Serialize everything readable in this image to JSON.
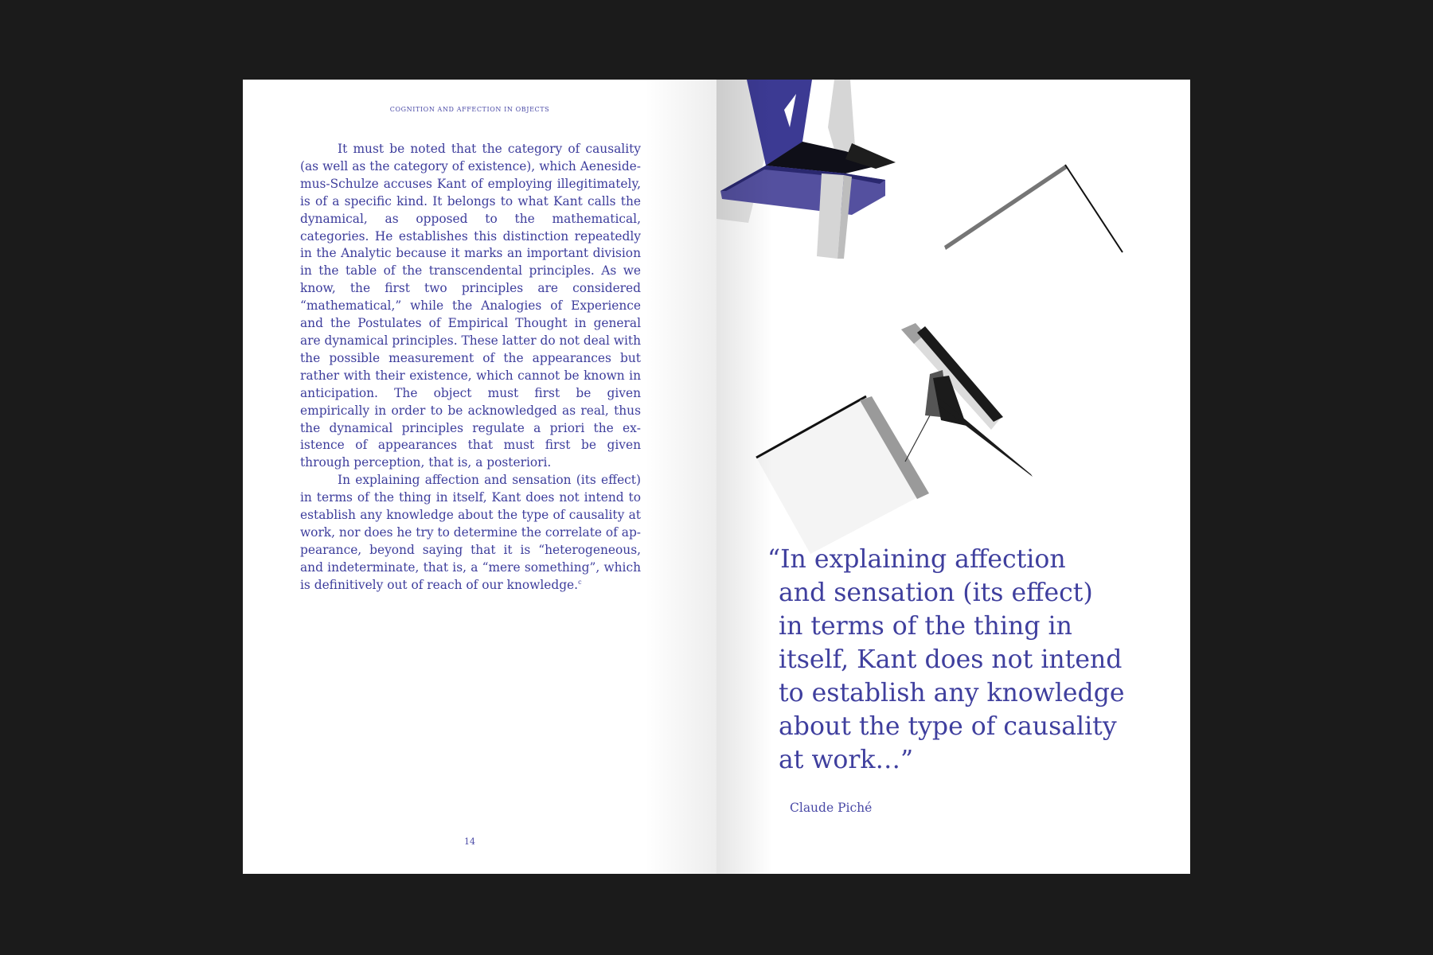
{
  "left_page": {
    "running_head": "Cognition and affection in objects",
    "paragraph_1": "It must be noted that the category of causality (as well as the category of existence), which Aeneside­mus-Schulze accuses Kant of employing illegitimately, is of a specific kind. It belongs to what Kant calls the dynamical, as opposed to the mathematical, categories. He establishes this distinction repeatedly in the Analyt­ic because it marks an important division in the table of the transcendental principles. As we know, the first two principles are considered “mathematical,” while the Analogies of Experience and the Postulates of Empiri­cal Thought in general are dynamical principles. These latter do not deal with the possible measurement of the appearances but rather with their existence, which can­not be known in anticipation. The object must first be given empirically in order to be acknowledged as real, thus the dynamical principles regulate a priori the ex­istence of appearances that must first be given through perception, that is, a posteriori.",
    "paragraph_2": "In explaining affection and sensation (its effect) in terms of the thing in itself, Kant does not intend to establish any knowledge about the type of causality at work, nor does he try to determine the correlate of ap­pearance, beyond saying that it is “heterogeneous, and indeterminate, that is, a “mere something”, which is definitively out of reach of our knowledge.",
    "footnote_marker": "c",
    "page_number": "14"
  },
  "right_page": {
    "quote_lines": [
      "“In explaining affection",
      "and sensation (its effect)",
      "in terms of the thing in",
      "itself, Kant does not intend",
      "to establish any knowledge",
      "about the type of causality",
      "at work…”"
    ],
    "attribution": "Claude Piché"
  },
  "colors": {
    "background": "#1b1b1b",
    "paper": "#ffffff",
    "text_accent": "#3d3d9c",
    "shape_purple": "#3a3790"
  }
}
